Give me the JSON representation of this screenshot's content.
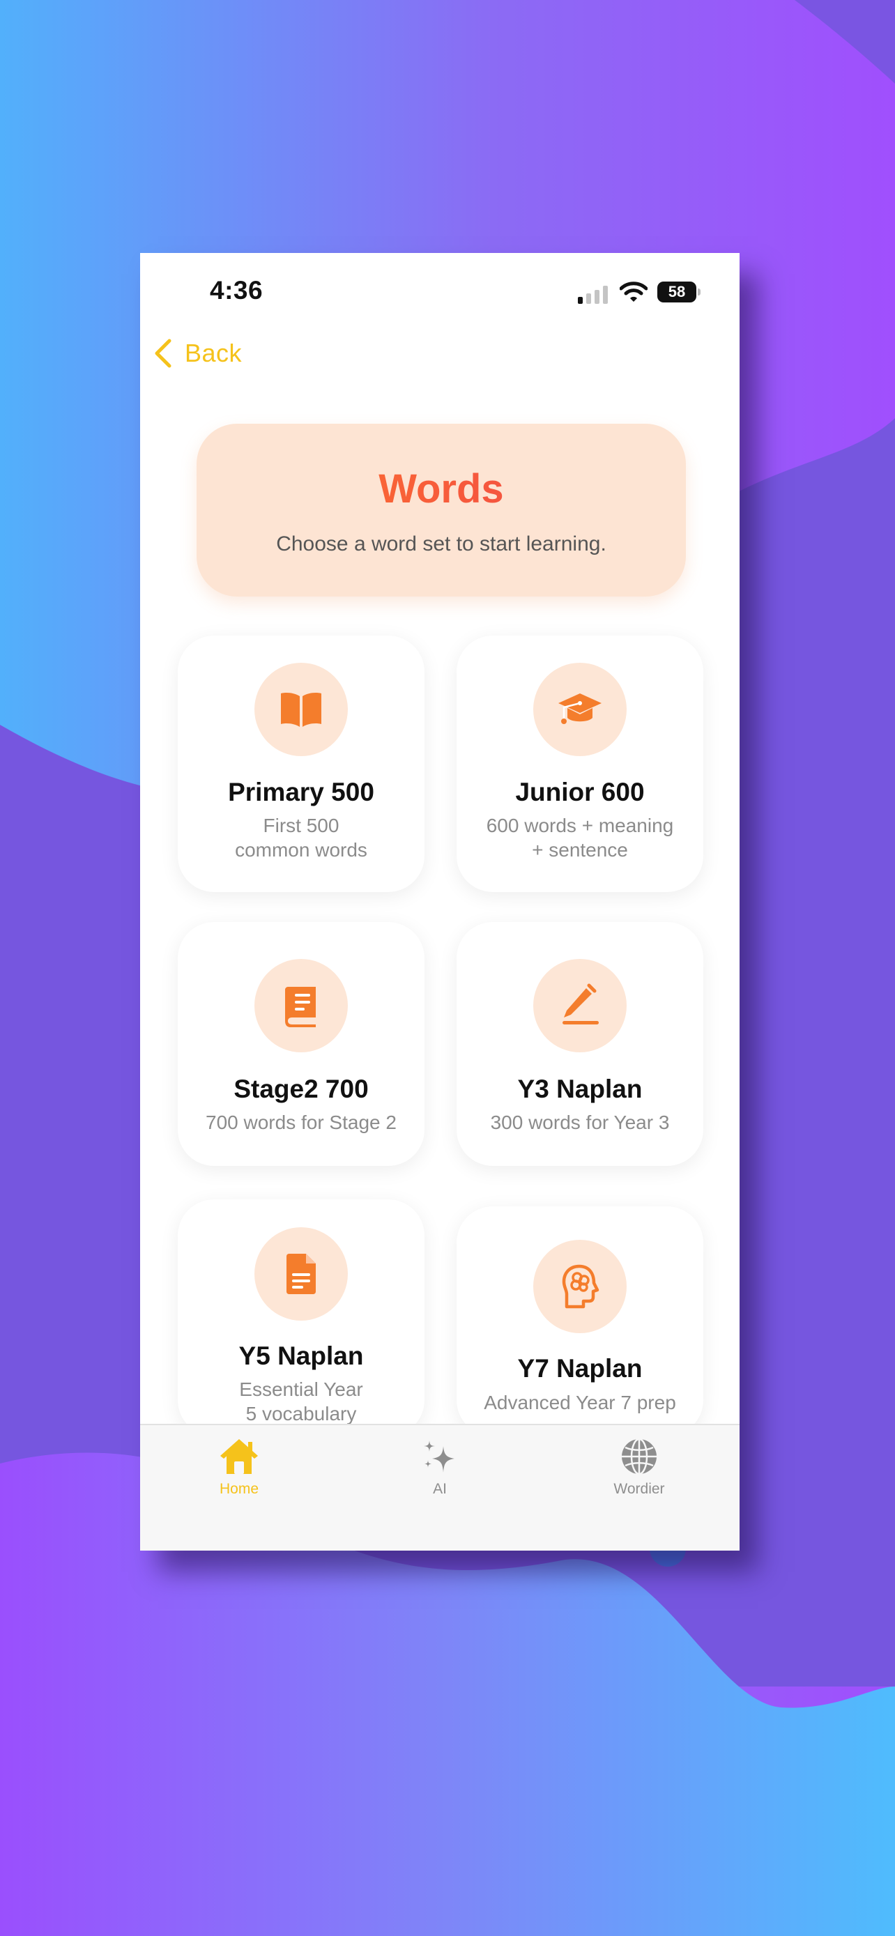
{
  "status_bar": {
    "time": "4:36",
    "battery": "58"
  },
  "nav": {
    "back_label": "Back"
  },
  "header": {
    "title": "Words",
    "subtitle": "Choose a word set to start learning."
  },
  "word_sets": [
    {
      "icon": "book-open-icon",
      "title": "Primary 500",
      "desc": "First 500\ncommon words"
    },
    {
      "icon": "graduation-cap-icon",
      "title": "Junior 600",
      "desc": "600 words + meaning\n+ sentence"
    },
    {
      "icon": "book-icon",
      "title": "Stage2 700",
      "desc": "700 words for Stage 2"
    },
    {
      "icon": "pencil-line-icon",
      "title": "Y3 Naplan",
      "desc": "300 words for Year 3"
    },
    {
      "icon": "document-icon",
      "title": "Y5 Naplan",
      "desc": "Essential Year\n5 vocabulary"
    },
    {
      "icon": "brain-head-icon",
      "title": "Y7 Naplan",
      "desc": "Advanced Year 7 prep"
    }
  ],
  "tabs": [
    {
      "icon": "house-icon",
      "label": "Home",
      "active": true
    },
    {
      "icon": "sparkles-icon",
      "label": "AI",
      "active": false
    },
    {
      "icon": "globe-icon",
      "label": "Wordier",
      "active": false
    }
  ],
  "colors": {
    "accent_orange": "#f47d2c",
    "icon_bg": "#fde6d6",
    "header_bg": "#fde4d3",
    "tab_active": "#f5c21b",
    "tab_inactive": "#8e8e8e",
    "back": "#f5c21b"
  }
}
